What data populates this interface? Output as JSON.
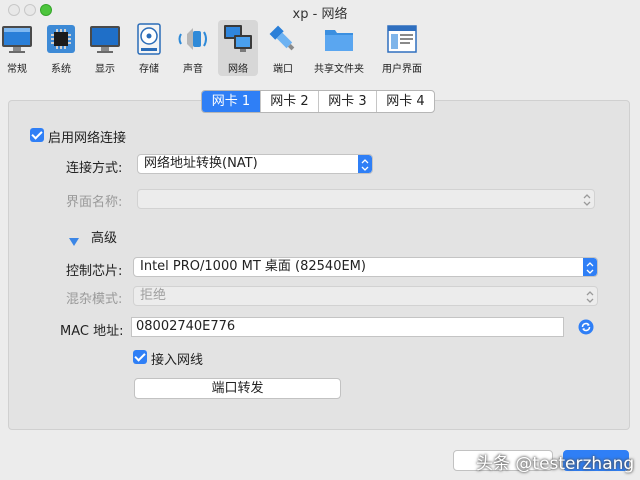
{
  "window": {
    "title": "xp - 网络"
  },
  "toolbar": {
    "items": [
      {
        "label": "常规",
        "icon": "general-monitor-icon"
      },
      {
        "label": "系统",
        "icon": "chip-icon"
      },
      {
        "label": "显示",
        "icon": "display-monitor-icon"
      },
      {
        "label": "存储",
        "icon": "disk-icon"
      },
      {
        "label": "声音",
        "icon": "speaker-icon"
      },
      {
        "label": "网络",
        "icon": "network-icon",
        "selected": true
      },
      {
        "label": "端口",
        "icon": "serial-port-icon"
      },
      {
        "label": "共享文件夹",
        "icon": "folder-icon"
      },
      {
        "label": "用户界面",
        "icon": "user-interface-icon"
      }
    ]
  },
  "tabs": [
    {
      "label": "网卡 1",
      "active": true
    },
    {
      "label": "网卡 2",
      "active": false
    },
    {
      "label": "网卡 3",
      "active": false
    },
    {
      "label": "网卡 4",
      "active": false
    }
  ],
  "network": {
    "enable_label": "启用网络连接",
    "connection_label": "连接方式:",
    "connection_value": "网络地址转换(NAT)",
    "interface_label": "界面名称:",
    "interface_value": "",
    "advanced_label": "高级",
    "adapter_label": "控制芯片:",
    "adapter_value": "Intel PRO/1000 MT 桌面 (82540EM)",
    "promisc_label": "混杂模式:",
    "promisc_value": "拒绝",
    "mac_label": "MAC 地址:",
    "mac_value": "08002740E776",
    "cable_label": "接入网线",
    "port_forward_label": "端口转发"
  },
  "watermark": "头条 @testerzhang",
  "colors": {
    "accent": "#2f7ff6",
    "panel": "#e3e3e3",
    "window": "#ececec"
  }
}
